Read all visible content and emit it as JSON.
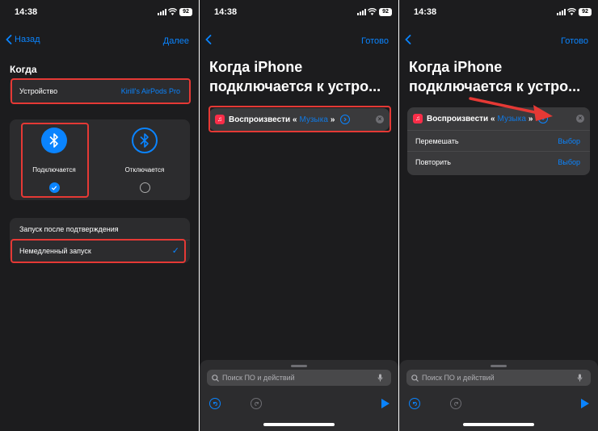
{
  "status": {
    "time": "14:38",
    "battery": "92"
  },
  "screen1": {
    "nav_back": "Назад",
    "nav_right": "Далее",
    "section_title": "Когда",
    "device_label": "Устройство",
    "device_value": "Kirill's AirPods Pro",
    "connect_label": "Подключается",
    "disconnect_label": "Отключается",
    "run_after_confirm": "Запуск после подтверждения",
    "run_immediately": "Немедленный запуск"
  },
  "screen2": {
    "nav_right": "Готово",
    "title_line1": "Когда iPhone",
    "title_line2": "подключается к устро...",
    "action_label": "Воспроизвести «",
    "action_token": "Музыка",
    "action_close_quote": "»"
  },
  "screen3": {
    "nav_right": "Готово",
    "title_line1": "Когда iPhone",
    "title_line2": "подключается к устро...",
    "action_label": "Воспроизвести «",
    "action_token": "Музыка",
    "action_close_quote": "»",
    "shuffle_label": "Перемешать",
    "shuffle_value": "Выбор",
    "repeat_label": "Повторить",
    "repeat_value": "Выбор"
  },
  "bottom": {
    "search_placeholder": "Поиск ПО и действий"
  },
  "icons": {
    "back": "chevron-left-icon",
    "bluetooth": "bluetooth-icon",
    "check": "checkmark-icon",
    "music": "music-note-icon",
    "expand": "chevron-circle-icon",
    "remove": "x-circle-icon",
    "search": "search-icon",
    "mic": "microphone-icon",
    "undo": "undo-icon",
    "redo": "redo-icon",
    "play": "play-icon"
  },
  "colors": {
    "accent": "#0a84ff",
    "highlight": "#e53935",
    "music": "#fa2d48",
    "background": "#1c1c1e"
  }
}
